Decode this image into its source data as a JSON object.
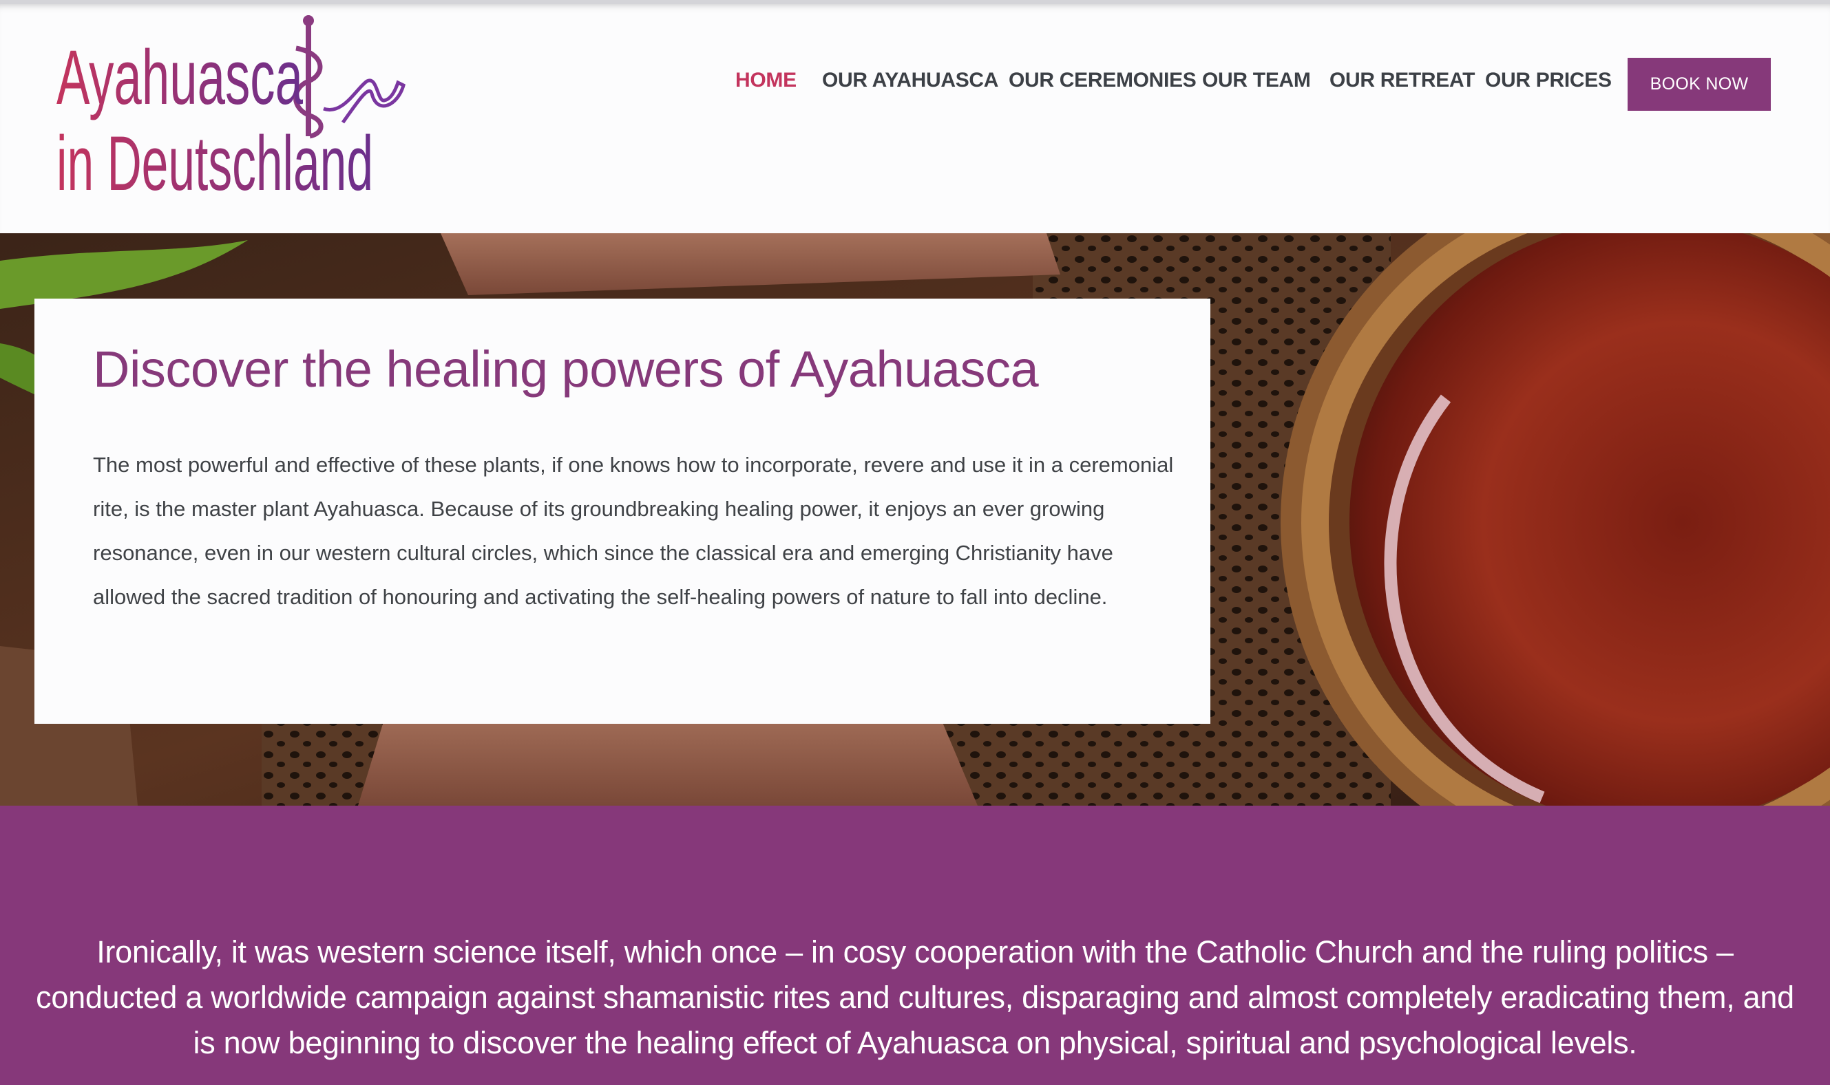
{
  "brand": {
    "line1": "Ayahuasca",
    "line2": "in Deutschland",
    "gradient_from": "#c3345d",
    "gradient_to": "#6a2f8c"
  },
  "nav": {
    "items": [
      {
        "label": "HOME",
        "active": true
      },
      {
        "label": "OUR AYAHUASCA",
        "active": false
      },
      {
        "label": "OUR CEREMONIES",
        "active": false
      },
      {
        "label": "OUR TEAM",
        "active": false
      },
      {
        "label": "OUR RETREAT",
        "active": false
      },
      {
        "label": "OUR PRICES",
        "active": false
      }
    ],
    "cta": "BOOK NOW",
    "active_color": "#c3345d",
    "text_color": "#3c4046",
    "cta_color": "#86397a"
  },
  "hero": {
    "title": "Discover the healing powers of Ayahuasca",
    "body": "The most powerful and effective of these plants, if one knows how to incorporate, revere and use it in a ceremonial rite, is the master plant Ayahuasca. Because of its groundbreaking healing power, it enjoys an ever growing resonance, even in our western cultural circles, which since the classical era and emerging Christianity have allowed the sacred tradition of honouring and activating the self-healing powers of nature to fall into decline.",
    "title_color": "#86397a"
  },
  "quote": {
    "text": "Ironically, it was western science itself, which once – in cosy cooperation with the Catholic Church and the ruling politics – conducted a worldwide campaign against shamanistic rites and cultures, disparaging and almost completely eradicating them, and is now beginning to discover the healing effect of Ayahuasca on physical, spiritual and psychological levels.",
    "background": "#86387a"
  }
}
